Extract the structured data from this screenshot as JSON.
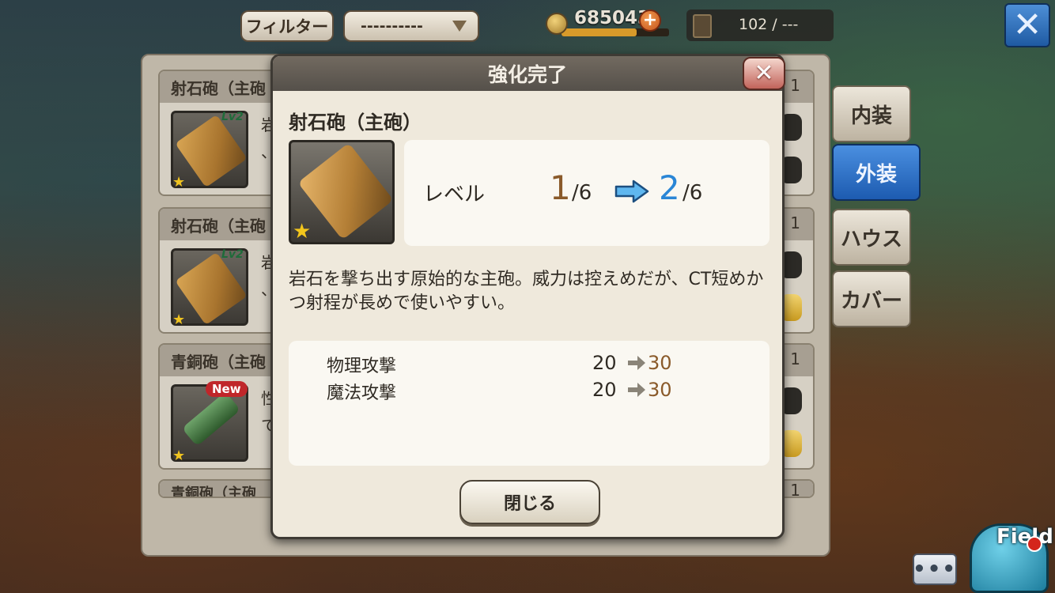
{
  "top_bar": {
    "filter_label": "フィルター",
    "filter_select_value": "----------",
    "coins": "685043",
    "coin_plus": "+",
    "storage": "102 / ---",
    "close_glyph": "✕"
  },
  "list": {
    "items": [
      {
        "title": "射石砲（主砲",
        "count": "1",
        "lv": "Lv2",
        "desc_start": "岩",
        "desc_2": "、",
        "icon": "rock-cannon-icon"
      },
      {
        "title": "射石砲（主砲",
        "count": "1",
        "lv": "Lv2",
        "desc_start": "岩",
        "desc_2": "、",
        "icon": "rock-cannon-icon"
      },
      {
        "title": "青銅砲（主砲",
        "count": "1",
        "badge": "New",
        "desc_start": "性",
        "desc_2": "て",
        "icon": "bronze-cannon-icon"
      },
      {
        "title": "青銅砲（主砲",
        "count": "1"
      }
    ]
  },
  "side_tabs": [
    {
      "label": "内装"
    },
    {
      "label": "外装",
      "active": true
    },
    {
      "label": "ハウス"
    },
    {
      "label": "カバー"
    }
  ],
  "modal": {
    "title": "強化完了",
    "close_glyph": "✕",
    "item_name": "射石砲（主砲）",
    "level_label": "レベル",
    "level_from": "1",
    "level_from_max": "/6",
    "level_to": "2",
    "level_to_max": "/6",
    "description": "岩石を撃ち出す原始的な主砲。威力は控えめだが、CT短めかつ射程が長めで使いやすい。",
    "stats": [
      {
        "name": "物理攻撃",
        "from": "20",
        "to": "30"
      },
      {
        "name": "魔法攻撃",
        "from": "20",
        "to": "30"
      }
    ],
    "close_button": "閉じる"
  },
  "bottom": {
    "chat_glyph": "•••",
    "field_label": "Field"
  },
  "colors": {
    "accent_blue": "#2a86d6",
    "level_from": "#8a5a2a",
    "star": "#f3c61c"
  }
}
